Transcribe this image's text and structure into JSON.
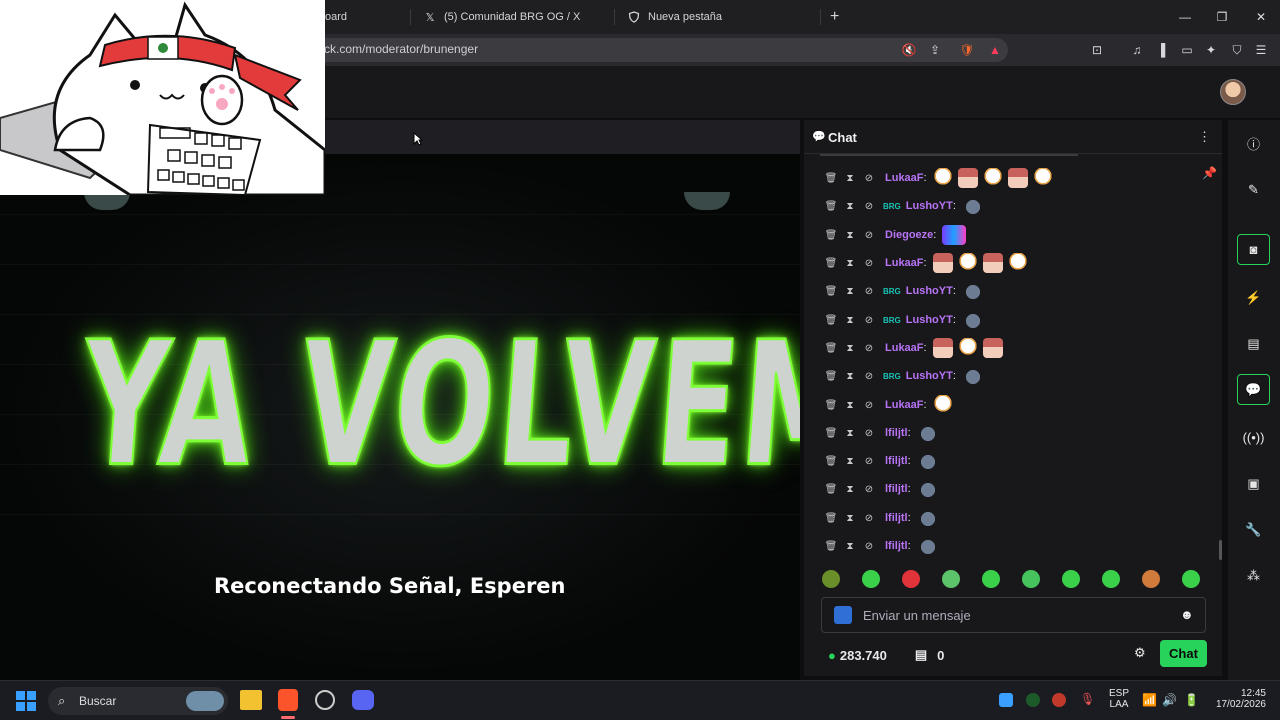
{
  "browser": {
    "tabs": [
      {
        "label": "oard",
        "icon": "dashboard-icon"
      },
      {
        "label": "(5) Comunidad BRG OG / X",
        "icon": "x-logo-icon"
      },
      {
        "label": "Nueva pestaña",
        "icon": "brave-shield-icon"
      }
    ],
    "new_tab": "+",
    "url": "ck.com/moderator/brunenger",
    "window_controls": [
      "minimize",
      "restore",
      "close"
    ]
  },
  "video": {
    "hero_text": "YA VOLVEMOS",
    "subtitle": "Reconectando Señal, Esperen"
  },
  "chat": {
    "title": "Chat",
    "messages": [
      {
        "user": "LukaaF",
        "badge": "",
        "emotes": [
          "duck",
          "girl",
          "duck",
          "girl",
          "duck"
        ]
      },
      {
        "user": "LushoYT",
        "badge": "BRG",
        "emotes": [
          "bird"
        ]
      },
      {
        "user": "Diegoeze",
        "badge": "",
        "emotes": [
          "tv"
        ]
      },
      {
        "user": "LukaaF",
        "badge": "",
        "emotes": [
          "girl",
          "duck",
          "girl",
          "duck"
        ]
      },
      {
        "user": "LushoYT",
        "badge": "BRG",
        "emotes": [
          "bird"
        ]
      },
      {
        "user": "LushoYT",
        "badge": "BRG",
        "emotes": [
          "bird"
        ]
      },
      {
        "user": "LukaaF",
        "badge": "",
        "emotes": [
          "girl",
          "duck",
          "girl"
        ]
      },
      {
        "user": "LushoYT",
        "badge": "BRG",
        "emotes": [
          "bird"
        ]
      },
      {
        "user": "LukaaF",
        "badge": "",
        "emotes": [
          "duck"
        ]
      },
      {
        "user": "lfiljtl",
        "badge": "",
        "emotes": [
          "bird"
        ]
      },
      {
        "user": "lfiljtl",
        "badge": "",
        "emotes": [
          "bird"
        ]
      },
      {
        "user": "lfiljtl",
        "badge": "",
        "emotes": [
          "bird"
        ]
      },
      {
        "user": "lfiljtl",
        "badge": "",
        "emotes": [
          "bird"
        ]
      },
      {
        "user": "lfiljtl",
        "badge": "",
        "emotes": [
          "bird"
        ]
      }
    ],
    "input_placeholder": "Enviar un mensaje",
    "points": "283.740",
    "drops": "0",
    "send_label": "Chat"
  },
  "taskbar": {
    "search_placeholder": "Buscar",
    "lang_top": "ESP",
    "lang_bottom": "LAA",
    "time": "12:45",
    "date": "17/02/2026"
  },
  "colors": {
    "accent": "#27d35a",
    "username": "#b774f5",
    "neon": "#7dff37"
  }
}
